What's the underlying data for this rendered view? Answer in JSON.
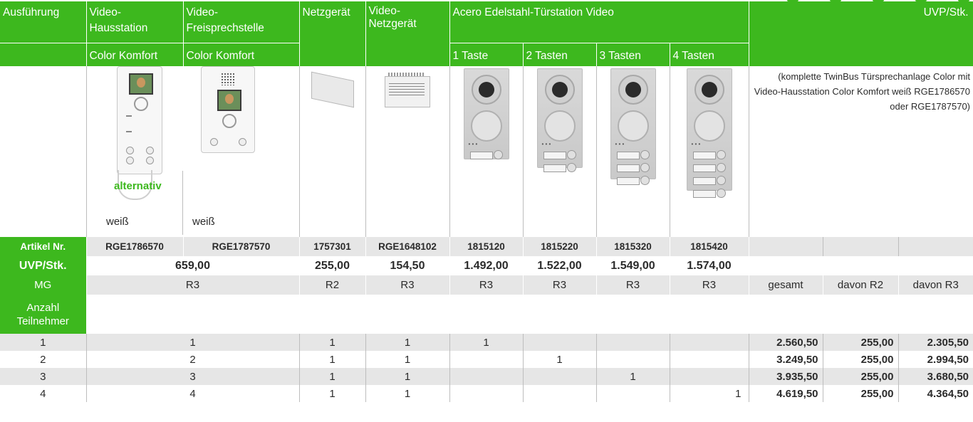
{
  "header": {
    "ausfuehrung": "Ausführung",
    "col_haus": [
      "Video-",
      "Hausstation",
      "Color Komfort"
    ],
    "col_frei": [
      "Video-",
      "Freisprechstelle",
      "Color Komfort"
    ],
    "col_netz": "Netzgerät",
    "col_vnetz": [
      "Video-",
      "Netzgerät"
    ],
    "acero": "Acero Edelstahl-Türstation Video",
    "uvp_stk": "UVP/Stk.",
    "tasten": [
      "1 Taste",
      "2 Tasten",
      "3 Tasten",
      "4 Tasten"
    ]
  },
  "images": {
    "alternativ": "alternativ",
    "weiss": "weiß",
    "note": "(komplette TwinBus Türsprechanlage Color mit Video-Hausstation Color Komfort weiß RGE1786570 oder RGE1787570)"
  },
  "rows": {
    "artikel_label": "Artikel Nr.",
    "artikel": [
      "RGE1786570",
      "RGE1787570",
      "1757301",
      "RGE1648102",
      "1815120",
      "1815220",
      "1815320",
      "1815420"
    ],
    "uvp_label": "UVP/Stk.",
    "uvp": [
      "659,00",
      "255,00",
      "154,50",
      "1.492,00",
      "1.522,00",
      "1.549,00",
      "1.574,00"
    ],
    "mg_label": "MG",
    "mg": [
      "R3",
      "R2",
      "R3",
      "R3",
      "R3",
      "R3",
      "R3"
    ],
    "mg_sums": [
      "gesamt",
      "davon R2",
      "davon R3"
    ],
    "anzahl_label": "Anzahl Teilnehmer"
  },
  "data": [
    {
      "n": "1",
      "haus": "1",
      "netz": "1",
      "vnetz": "1",
      "t1": "1",
      "t2": "",
      "t3": "",
      "t4": "",
      "gesamt": "2.560,50",
      "r2": "255,00",
      "r3": "2.305,50"
    },
    {
      "n": "2",
      "haus": "2",
      "netz": "1",
      "vnetz": "1",
      "t1": "",
      "t2": "1",
      "t3": "",
      "t4": "",
      "gesamt": "3.249,50",
      "r2": "255,00",
      "r3": "2.994,50"
    },
    {
      "n": "3",
      "haus": "3",
      "netz": "1",
      "vnetz": "1",
      "t1": "",
      "t2": "",
      "t3": "1",
      "t4": "",
      "gesamt": "3.935,50",
      "r2": "255,00",
      "r3": "3.680,50"
    },
    {
      "n": "4",
      "haus": "4",
      "netz": "1",
      "vnetz": "1",
      "t1": "",
      "t2": "",
      "t3": "",
      "t4": "1",
      "gesamt": "4.619,50",
      "r2": "255,00",
      "r3": "4.364,50"
    }
  ],
  "colors": {
    "brand_green": "#3db81e",
    "row_grey": "#e6e6e6"
  }
}
